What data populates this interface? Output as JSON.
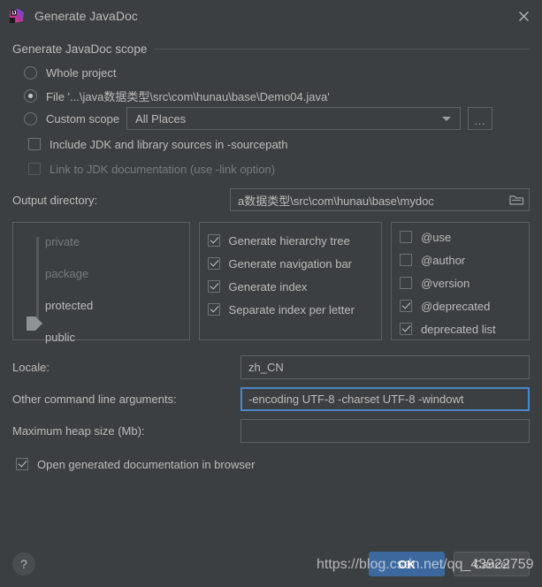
{
  "window": {
    "title": "Generate JavaDoc",
    "app_icon": "intellij-idea-icon",
    "close_icon": "close-icon"
  },
  "scope_group": {
    "title": "Generate JavaDoc scope",
    "options": [
      {
        "label": "Whole project",
        "mnemonic": "p",
        "selected": false
      },
      {
        "label": "File '...\\java数据类型\\src\\com\\hunau\\base\\Demo04.java'",
        "mnemonic": "F",
        "selected": true
      },
      {
        "label": "Custom scope",
        "mnemonic": "C",
        "selected": false
      }
    ],
    "custom_scope_value": "All Places",
    "browse_label": "..."
  },
  "source_options": [
    {
      "label": "Include JDK and library sources in -sourcepath",
      "checked": false,
      "disabled": false
    },
    {
      "label": "Link to JDK documentation (use -link option)",
      "checked": false,
      "disabled": true
    }
  ],
  "output_directory": {
    "label": "Output directory:",
    "mnemonic": "d",
    "value": "a数据类型\\src\\com\\hunau\\base\\mydoc",
    "browse_icon": "folder-icon"
  },
  "visibility_panel": {
    "levels": [
      "private",
      "package",
      "protected",
      "public"
    ],
    "selected": "protected"
  },
  "flags_panel": [
    {
      "label": "Generate hierarchy tree",
      "checked": true
    },
    {
      "label": "Generate navigation bar",
      "checked": true
    },
    {
      "label": "Generate index",
      "checked": true
    },
    {
      "label": "Separate index per letter",
      "checked": true
    }
  ],
  "tags_panel": [
    {
      "label": "@use",
      "checked": false
    },
    {
      "label": "@author",
      "checked": false
    },
    {
      "label": "@version",
      "checked": false
    },
    {
      "label": "@deprecated",
      "checked": true
    },
    {
      "label": "deprecated list",
      "checked": true
    }
  ],
  "locale": {
    "label": "Locale:",
    "mnemonic": "L",
    "value": "zh_CN"
  },
  "cmdline": {
    "label": "Other command line arguments:",
    "mnemonic": "O",
    "value": "-encoding UTF-8 -charset UTF-8 -windowt",
    "focused": true
  },
  "heap": {
    "label": "Maximum heap size (Mb):",
    "mnemonic": "M",
    "value": ""
  },
  "open_in_browser": {
    "label": "Open generated documentation in browser",
    "checked": true
  },
  "footer": {
    "help_label": "?",
    "ok_label": "OK",
    "cancel_label": "Cancel"
  },
  "watermark": "https://blog.csdn.net/qq_43922759",
  "colors": {
    "background": "#3c3f41",
    "accent_primary": "#3c689e",
    "focus_border": "#4a88c7",
    "text": "#bbbbbb",
    "disabled_text": "#787b7d"
  }
}
